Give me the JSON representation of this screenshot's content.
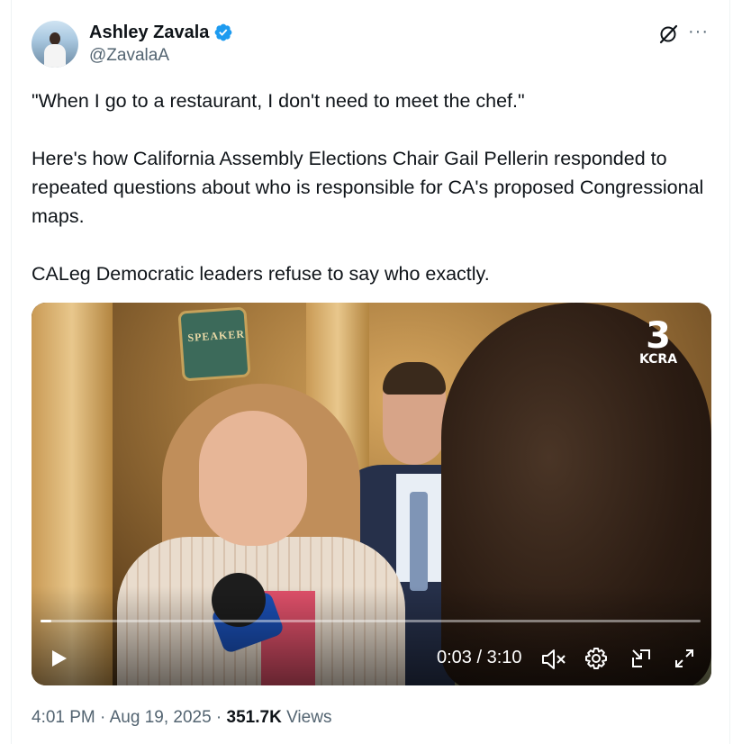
{
  "author": {
    "name": "Ashley Zavala",
    "handle": "@ZavalaA",
    "verified_color": "#1d9bf0",
    "avatar_icon": "avatar"
  },
  "header_actions": {
    "grok_icon": "grok-icon",
    "more_label": "···"
  },
  "tweet_text": "\"When I go to a restaurant, I don't need to meet the chef.\"\n\nHere's how California Assembly Elections Chair Gail Pellerin responded to repeated questions about who is responsible for CA's proposed Congressional maps.\n\nCALeg Democratic leaders refuse to say who exactly.",
  "video": {
    "station_number": "3",
    "station_name": "KCRA",
    "sign_text": "SPEAKER",
    "time_display": "0:03 / 3:10",
    "progress": 0.016,
    "controls": [
      "play-icon",
      "mute-icon",
      "settings-icon",
      "pip-icon",
      "fullscreen-icon"
    ]
  },
  "footer": {
    "time": "4:01 PM",
    "sep1": " · ",
    "date": "Aug 19, 2025",
    "sep2": " · ",
    "views_count": "351.7K",
    "views_label": " Views"
  }
}
